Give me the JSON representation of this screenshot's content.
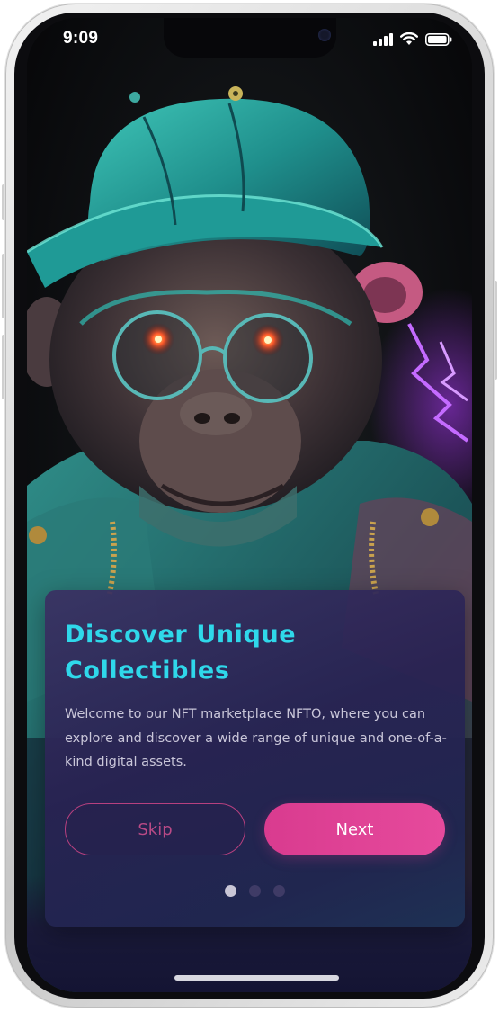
{
  "status_bar": {
    "time": "9:09"
  },
  "onboarding": {
    "title": "Discover Unique Collectibles",
    "body": "Welcome to our NFT marketplace NFTO, where you can explore and discover a wide range of unique and one-of-a-kind digital assets.",
    "skip_label": "Skip",
    "next_label": "Next",
    "pagination": {
      "total": 3,
      "active_index": 0
    }
  },
  "colors": {
    "title_accent": "#2fd8ea",
    "primary_button": "#e0448f",
    "skip_outline": "#b7407f",
    "card_background": "#2c2657"
  },
  "icons": {
    "signal": "cellular-signal-icon",
    "wifi": "wifi-icon",
    "battery": "battery-icon"
  }
}
